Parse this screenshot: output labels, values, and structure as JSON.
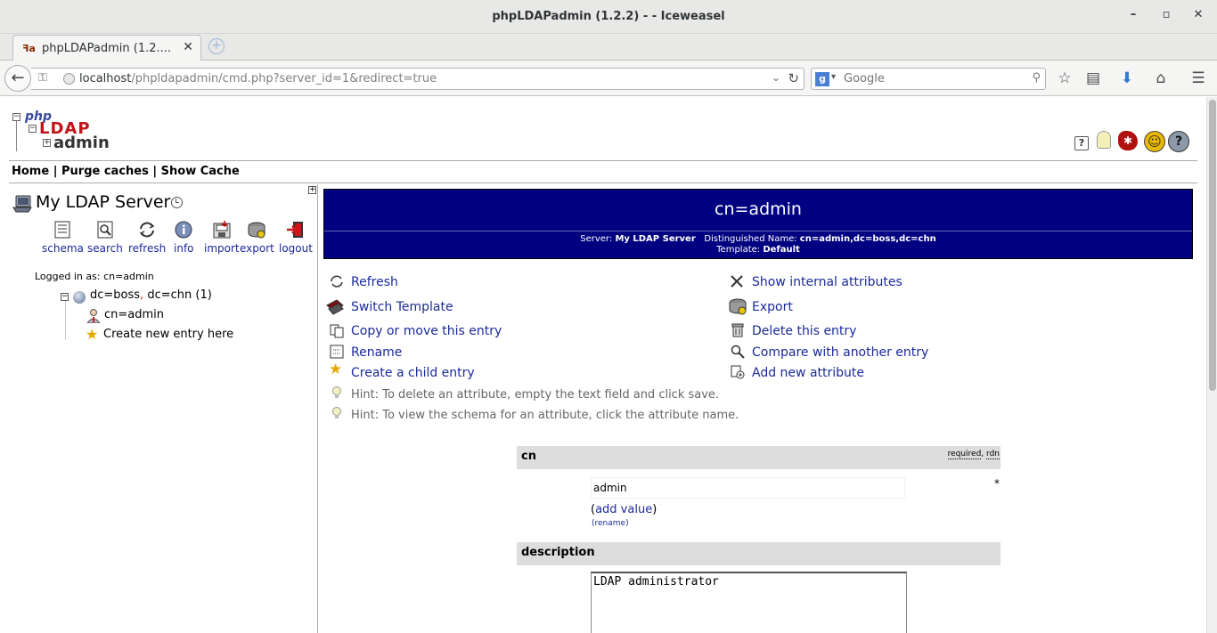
{
  "window": {
    "title": "phpLDAPadmin (1.2.2) - - Iceweasel",
    "minimize": "–",
    "maximize": "▫",
    "close": "✕"
  },
  "tab": {
    "label": "phpLDAPadmin (1.2....",
    "close": "✕"
  },
  "address": {
    "host": "localhost",
    "path": "/phpldapadmin/cmd.php?server_id=1&redirect=true"
  },
  "search": {
    "placeholder": "Google",
    "engine": "g"
  },
  "app": {
    "logo": {
      "php": "php",
      "ldap": "LDAP",
      "admin": "admin"
    },
    "topnav": {
      "home": "Home",
      "purge": "Purge caches",
      "show_cache": "Show Cache",
      "sep": " | "
    },
    "server_name": "My LDAP Server",
    "tools": [
      "schema",
      "search",
      "refresh",
      "info",
      "import",
      "export",
      "logout"
    ],
    "logged_in": "Logged in as: cn=admin",
    "tree": {
      "root_a": "dc=boss",
      "root_sep": ",",
      "root_b": " dc=chn (1)",
      "child": "cn=admin",
      "create": "Create new entry here"
    }
  },
  "entry": {
    "title": "cn=admin",
    "server_label": "Server:",
    "server_value": "My LDAP Server",
    "dn_label": "Distinguished Name:",
    "dn_value": "cn=admin,dc=boss,dc=chn",
    "template_label": "Template:",
    "template_value": "Default"
  },
  "actions": {
    "left": [
      "Refresh",
      "Switch Template",
      "Copy or move this entry",
      "Rename",
      "Create a child entry"
    ],
    "right": [
      "Show internal attributes",
      "Export",
      "Delete this entry",
      "Compare with another entry",
      "Add new attribute"
    ]
  },
  "hints": [
    "Hint: To delete an attribute, empty the text field and click save.",
    "Hint: To view the schema for an attribute, click the attribute name."
  ],
  "attributes": {
    "cn": {
      "name": "cn",
      "flag_required": "required",
      "flag_rdn": "rdn",
      "value": "admin",
      "required_mark": "*",
      "add_value_open": "(",
      "add_value": "add value",
      "add_value_close": ")",
      "rename": "(rename)"
    },
    "description": {
      "name": "description",
      "value": "LDAP administrator"
    }
  },
  "colors": {
    "header_bg": "#000080",
    "link": "#1a2a99",
    "attr_bar": "#dddddd"
  }
}
